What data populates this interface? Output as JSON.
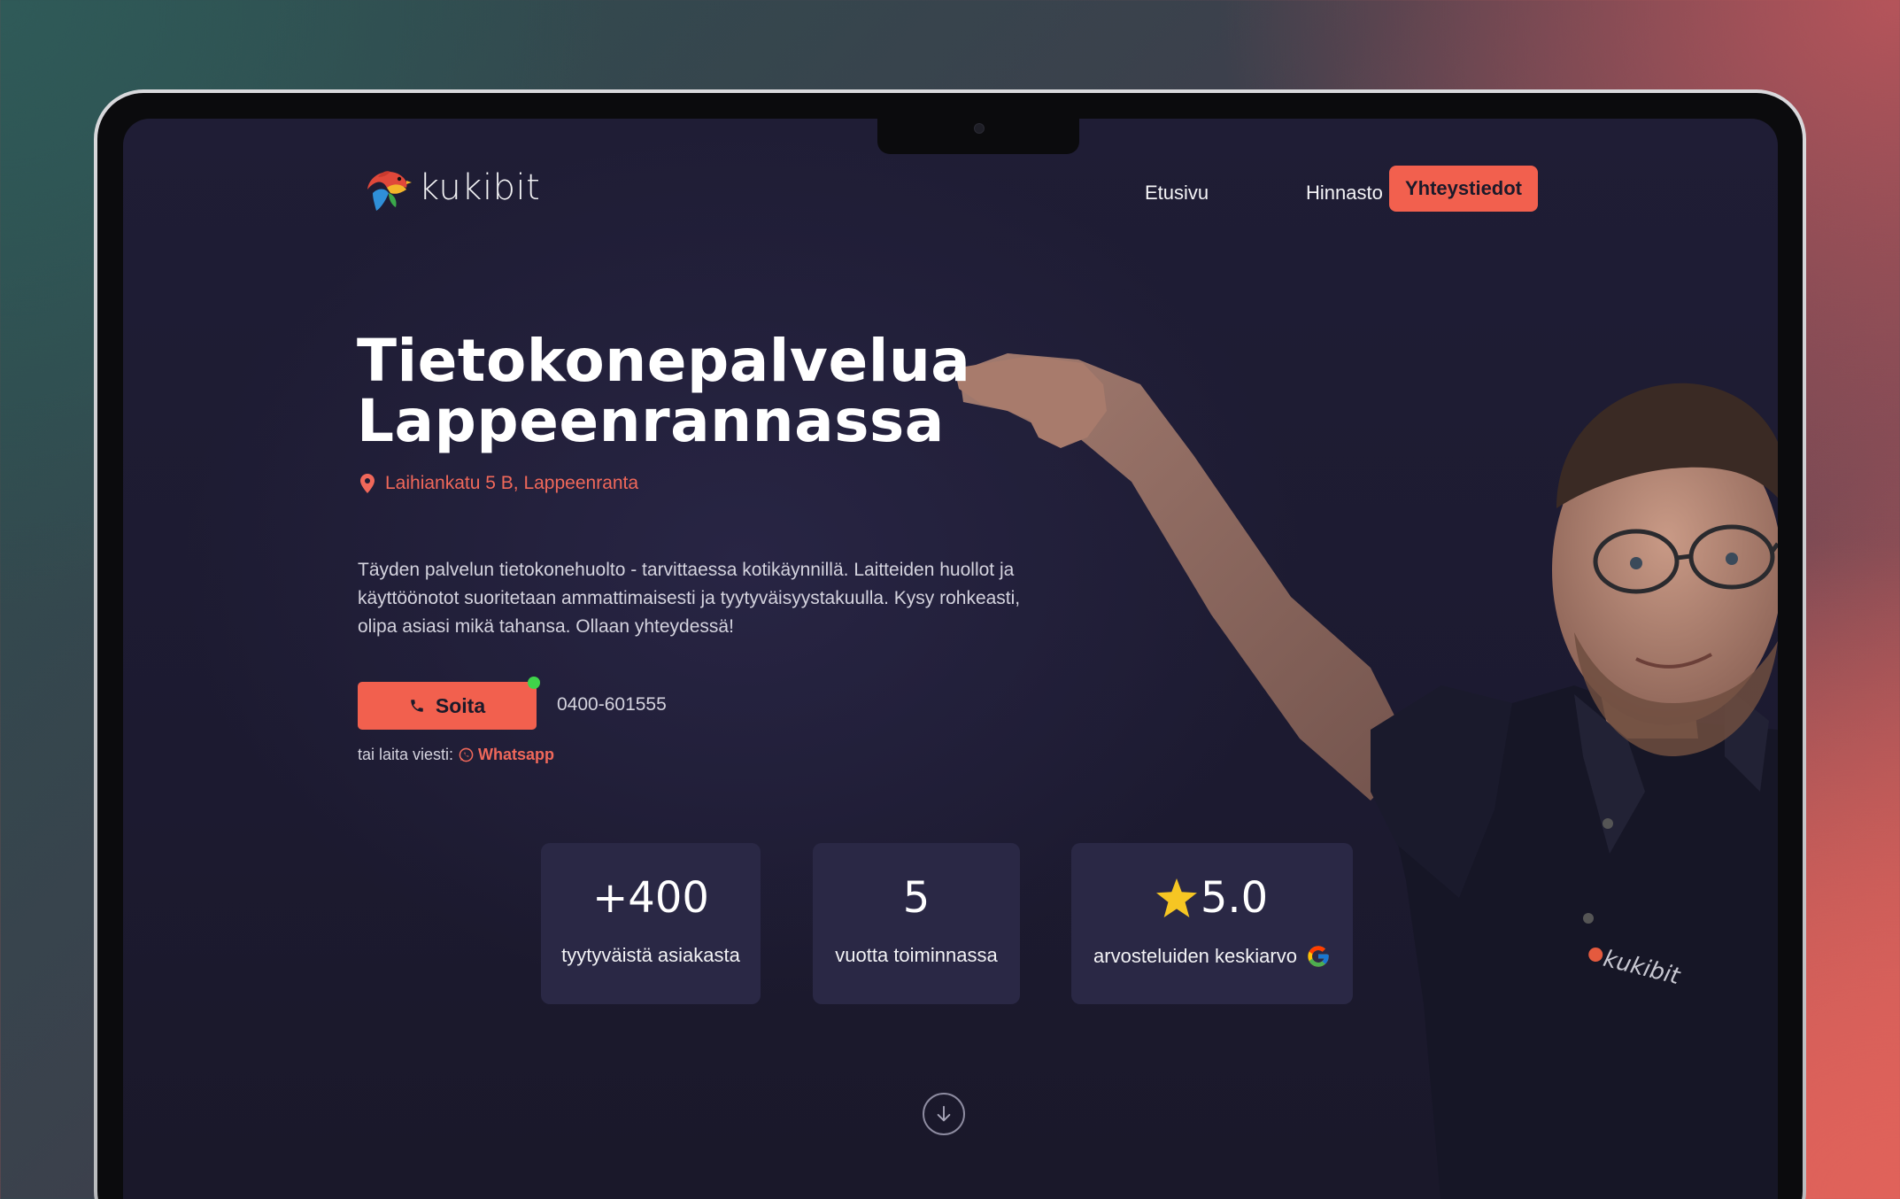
{
  "brand": {
    "name": "kukibit",
    "logo_icon": "colorful-bird-icon"
  },
  "nav": {
    "items": [
      {
        "label": "Etusivu"
      },
      {
        "label": "Hinnasto"
      }
    ],
    "cta_label": "Yhteystiedot"
  },
  "hero": {
    "title_line1": "Tietokonepalvelua",
    "title_line2": "Lappeenrannassa",
    "address": "Laihiankatu 5 B, Lappeenranta",
    "description": "Täyden palvelun tietokonehuolto - tarvittaessa kotikäynnillä. Laitteiden huollot ja käyttöönotot suoritetaan ammattimaisesti ja tyytyväisyystakuulla. Kysy rohkeasti, olipa asiasi mikä tahansa. Ollaan yhteydessä!",
    "call_label": "Soita",
    "phone": "0400-601555",
    "alt_prefix": "tai laita viesti:",
    "whatsapp_label": "Whatsapp",
    "shirt_logo_text": "kukibit"
  },
  "stats": [
    {
      "value": "+400",
      "label": "tyytyväistä asiakasta"
    },
    {
      "value": "5",
      "label": "vuotta toiminnassa"
    },
    {
      "value": "5.0",
      "label": "arvosteluiden keskiarvo",
      "icon": "star-icon",
      "badge": "google-icon"
    }
  ],
  "colors": {
    "accent": "#f2604e",
    "background": "#1f1d35",
    "card": "#2a2845",
    "online": "#3fd44a"
  }
}
